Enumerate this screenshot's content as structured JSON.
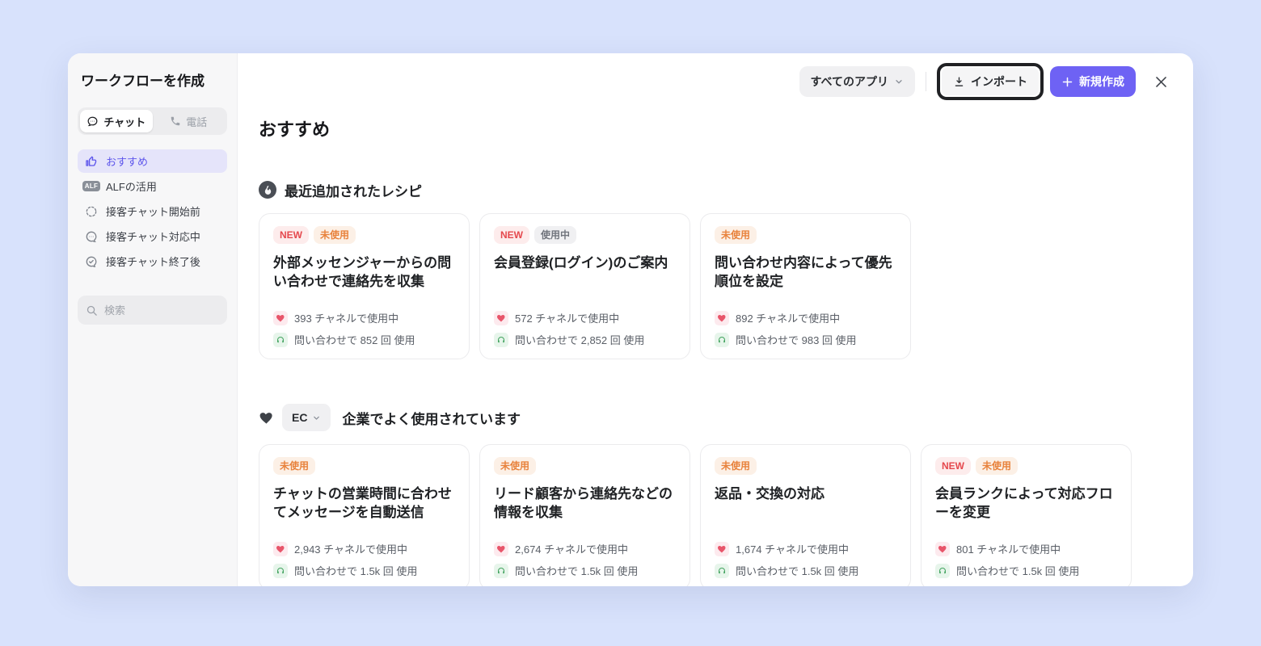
{
  "window": {
    "title": "ワークフローを作成"
  },
  "sidebar": {
    "tabs": [
      {
        "label": "チャット"
      },
      {
        "label": "電話"
      }
    ],
    "items": [
      {
        "label": "おすすめ"
      },
      {
        "label": "ALFの活用",
        "badge": "ALF"
      },
      {
        "label": "接客チャット開始前"
      },
      {
        "label": "接客チャット対応中"
      },
      {
        "label": "接客チャット終了後"
      }
    ],
    "search": {
      "placeholder": "検索"
    }
  },
  "header": {
    "filter_label": "すべてのアプリ",
    "import_label": "インポート",
    "create_label": "新規作成"
  },
  "main": {
    "page_title": "おすすめ",
    "sections": [
      {
        "title": "最近追加されたレシピ",
        "cards": [
          {
            "badges": [
              {
                "label": "NEW",
                "type": "new"
              },
              {
                "label": "未使用",
                "type": "unused"
              }
            ],
            "title": "外部メッセンジャーからの問い合わせで連絡先を収集",
            "channels": "393 チャネルで使用中",
            "usage": "問い合わせで 852 回 使用"
          },
          {
            "badges": [
              {
                "label": "NEW",
                "type": "new"
              },
              {
                "label": "使用中",
                "type": "used"
              }
            ],
            "title": "会員登録(ログイン)のご案内",
            "channels": "572 チャネルで使用中",
            "usage": "問い合わせで 2,852 回 使用"
          },
          {
            "badges": [
              {
                "label": "未使用",
                "type": "unused"
              }
            ],
            "title": "問い合わせ内容によって優先順位を設定",
            "channels": "892 チャネルで使用中",
            "usage": "問い合わせで 983 回 使用"
          }
        ]
      },
      {
        "filter_label": "EC",
        "title": "企業でよく使用されています",
        "cards": [
          {
            "badges": [
              {
                "label": "未使用",
                "type": "unused"
              }
            ],
            "title": "チャットの営業時間に合わせてメッセージを自動送信",
            "channels": "2,943 チャネルで使用中",
            "usage": "問い合わせで 1.5k 回 使用"
          },
          {
            "badges": [
              {
                "label": "未使用",
                "type": "unused"
              }
            ],
            "title": "リード顧客から連絡先などの情報を収集",
            "channels": "2,674 チャネルで使用中",
            "usage": "問い合わせで 1.5k 回 使用"
          },
          {
            "badges": [
              {
                "label": "未使用",
                "type": "unused"
              }
            ],
            "title": "返品・交換の対応",
            "channels": "1,674 チャネルで使用中",
            "usage": "問い合わせで 1.5k 回 使用"
          },
          {
            "badges": [
              {
                "label": "NEW",
                "type": "new"
              },
              {
                "label": "未使用",
                "type": "unused"
              }
            ],
            "title": "会員ランクによって対応フローを変更",
            "channels": "801 チャネルで使用中",
            "usage": "問い合わせで 1.5k 回 使用"
          }
        ]
      }
    ]
  },
  "colors": {
    "accent": "#6e62f4",
    "page_background": "#d8e2fc",
    "badge_new_text": "#e5484d",
    "badge_unused_text": "#e8823c",
    "badge_used_text": "#71757d",
    "active_item_text": "#5d55ec",
    "highlight_ring": "#202124",
    "stat_heart": "#e8556a",
    "stat_headset": "#42a35f"
  }
}
